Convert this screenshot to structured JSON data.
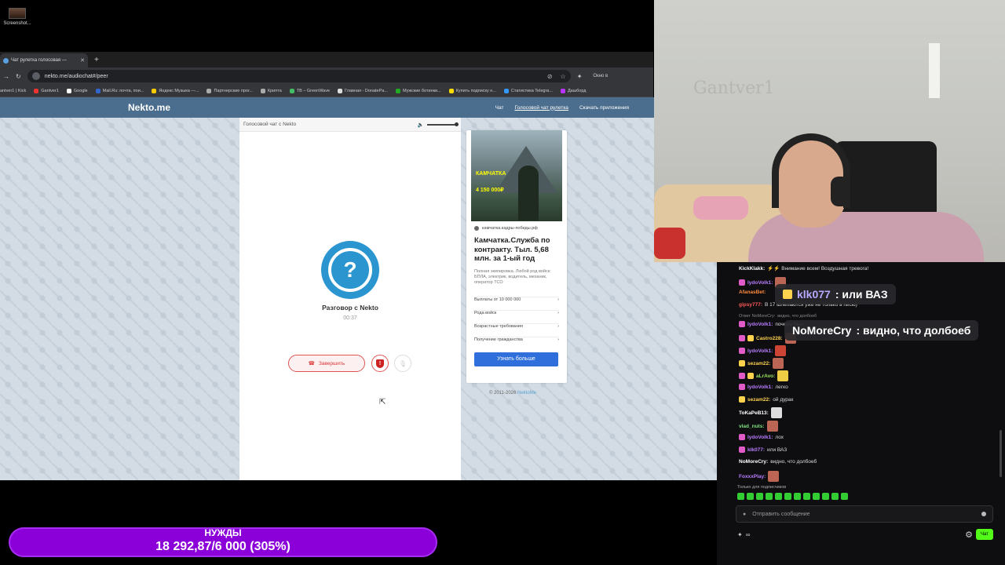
{
  "desktop": {
    "icon_label": "Screenshot..."
  },
  "browser": {
    "tab_title": "Чат рулетка голосовая —",
    "url": "nekto.me/audiochat#/peer",
    "window_mode": "Окно в",
    "bookmarks": [
      "antver1 | Kick",
      "Gantver1",
      "Google",
      "Mail.Ru: почта, пои...",
      "Яндекс Музыка —...",
      "Партнерские прог...",
      "Крипта",
      "TB – GreenWave",
      "Главная - DonatePa...",
      "Мужские ботинки...",
      "Купить подписку н...",
      "Статистика Telegra...",
      "Дашборд"
    ]
  },
  "nekto": {
    "logo": "Nekto.me",
    "nav": [
      "Чат",
      "Голосовой чат рулетка",
      "Скачать приложения"
    ],
    "chat_header": "Голосовой чат с Nekto",
    "volume_level": 1.0,
    "conversation_title": "Разговор с Nekto",
    "timer": "00:37",
    "end_button": "Завершить",
    "copyright_prefix": "© 2011-2026",
    "copyright_link": "NektoMe"
  },
  "ad": {
    "image_title": "КАМЧАТКА",
    "image_amount": "4 150 000₽",
    "domain": "камчатка.кадры-победы.рф",
    "title": "Камчатка.Служба по контракту. Тыл. 5,68 млн. за 1-ый год",
    "description": "Полная экипировка. Любой род войск: БПЛА, электрик, водитель, механик, оператор ТСО",
    "rows": [
      "Выплаты от 10 000 000",
      "Рода войск",
      "Возрастные требования",
      "Получение гражданства"
    ],
    "button": "Узнать больше"
  },
  "webcam": {
    "wall_text": "Gantver1"
  },
  "chat": {
    "messages": [
      {
        "user": "KickKlakk:",
        "text": "⚡⚡ Внимание всем! Воздушная тревога!",
        "color": "#ffffff"
      },
      {
        "user": "lydoVolk1:",
        "text": "",
        "color": "#b87cff"
      },
      {
        "user": "AfanasBet:",
        "text": "",
        "color": "#ff8a3d"
      },
      {
        "user": "gipsy777:",
        "text": "В 17 шлепаются уже не только в писю)",
        "color": "#ff5a5a"
      },
      {
        "user": "Ответ NoMoreCry:",
        "text": "видно, что долбоеб",
        "color": "#888888"
      },
      {
        "user": "lydoVolk1:",
        "text": "почему был",
        "color": "#b87cff"
      },
      {
        "user": "Castro228:",
        "text": "",
        "color": "#ffd24d"
      },
      {
        "user": "lydoVolk1:",
        "text": "",
        "color": "#b87cff"
      },
      {
        "user": "sezam22:",
        "text": "",
        "color": "#ffd24d"
      },
      {
        "user": "aLrAvo:",
        "text": "",
        "color": "#9adf5a"
      },
      {
        "user": "lydoVolk1:",
        "text": "легко",
        "color": "#b87cff"
      },
      {
        "user": "sezam22:",
        "text": "ой дурак",
        "color": "#ffd24d"
      },
      {
        "user": "ToKaPeB13:",
        "text": "",
        "color": "#ffffff"
      },
      {
        "user": "vlad_nuts:",
        "text": "",
        "color": "#7ee07e"
      },
      {
        "user": "lydoVolk1:",
        "text": "лох",
        "color": "#b87cff"
      },
      {
        "user": "klk077:",
        "text": "или ВАЗ",
        "color": "#b87cff"
      },
      {
        "user": "NoMoreCry:",
        "text": "видно, что долбоеб",
        "color": "#ffffff"
      },
      {
        "user": "FoxxxPlay:",
        "text": "",
        "color": "#b87cff"
      }
    ],
    "highlight1": {
      "user": "klk077",
      "text": ": или ВАЗ"
    },
    "highlight2": {
      "user": "NoMoreCry",
      "text": ": видно, что долбоеб"
    },
    "subs_only": "Только для подписчиков",
    "input_placeholder": "Отправить сообщение",
    "viewers": "∞",
    "send_label": "Чат"
  },
  "goal": {
    "label": "НУЖДЫ",
    "progress": "18 292,87/6 000 (305%)",
    "color": "#8b00d9"
  }
}
